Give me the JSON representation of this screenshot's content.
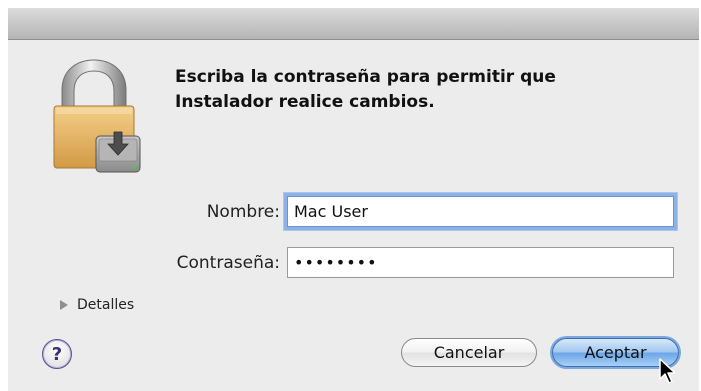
{
  "dialog": {
    "message_line1": "Escriba la contraseña para permitir que",
    "message_line2": "Instalador realice cambios.",
    "icon": "lock-with-disk-icon"
  },
  "form": {
    "username_label": "Nombre:",
    "username_value": "Mac User",
    "password_label": "Contraseña:",
    "password_masked": "••••••••"
  },
  "details": {
    "label": "Detalles",
    "icon": "disclosure-triangle-icon"
  },
  "buttons": {
    "help_label": "?",
    "cancel_label": "Cancelar",
    "ok_label": "Aceptar"
  },
  "colors": {
    "window_bg": "#ececec",
    "focus_ring": "#8db2e8",
    "default_button": "#6aa5e6",
    "lock_body": "#e8b25c"
  }
}
